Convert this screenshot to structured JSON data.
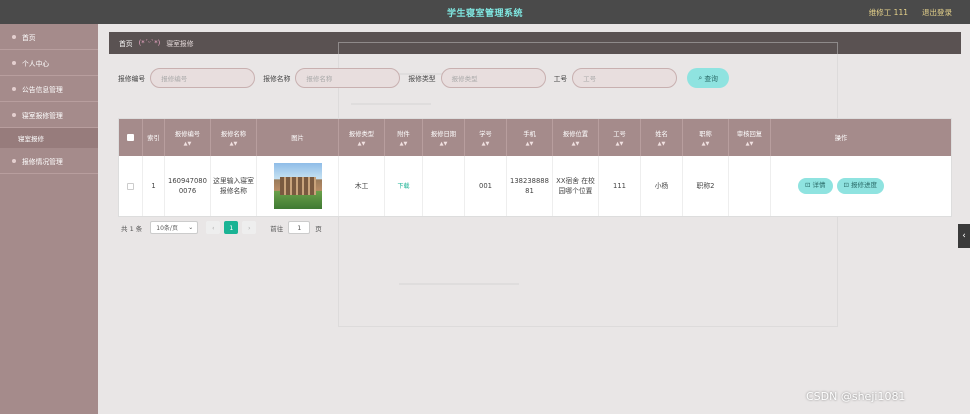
{
  "header": {
    "title": "学生寝室管理系统",
    "user": "维修工 111",
    "logout": "退出登录"
  },
  "sidebar": {
    "items": [
      {
        "label": "首页"
      },
      {
        "label": "个人中心"
      },
      {
        "label": "公告信息管理"
      },
      {
        "label": "寝室报修管理"
      }
    ],
    "sub_item": "寝室报修",
    "last_item": "报修情况管理"
  },
  "breadcrumb": {
    "home": "首页",
    "sep": "(*ˊᵕˋ*)",
    "current": "寝室报修"
  },
  "filters": [
    {
      "label": "报修编号",
      "placeholder": "报修编号"
    },
    {
      "label": "报修名称",
      "placeholder": "报修名称"
    },
    {
      "label": "报修类型",
      "placeholder": "报修类型"
    },
    {
      "label": "工号",
      "placeholder": "工号"
    }
  ],
  "search_label": "查询",
  "table": {
    "headers": [
      "索引",
      "报修编号",
      "报修名称",
      "图片",
      "报修类型",
      "附件",
      "报修日期",
      "学号",
      "手机",
      "报修位置",
      "工号",
      "姓名",
      "职称",
      "审核回复",
      "操作"
    ],
    "row": {
      "index": "1",
      "code": "1609470800076",
      "name": "这里输入寝室报修名称",
      "type": "木工",
      "attachment": "下载",
      "date": "",
      "student_no": "001",
      "phone": "13823888881",
      "location": "XX宿舍 在校园哪个位置",
      "worker_no": "111",
      "worker_name": "小杨",
      "title": "职称2",
      "reply": "",
      "detail_btn": "详情",
      "progress_btn": "报修进度"
    }
  },
  "pager": {
    "total": "共 1 条",
    "page_size": "10条/页",
    "current": "1",
    "goto_label": "前往",
    "goto_value": "1",
    "page_unit": "页"
  },
  "watermark": "CSDN @sheji1081",
  "colors": {
    "sidebar": "#a58b8b",
    "header": "#4a4a4a",
    "accent": "#8fe3e0",
    "pager_active": "#1ab394"
  }
}
